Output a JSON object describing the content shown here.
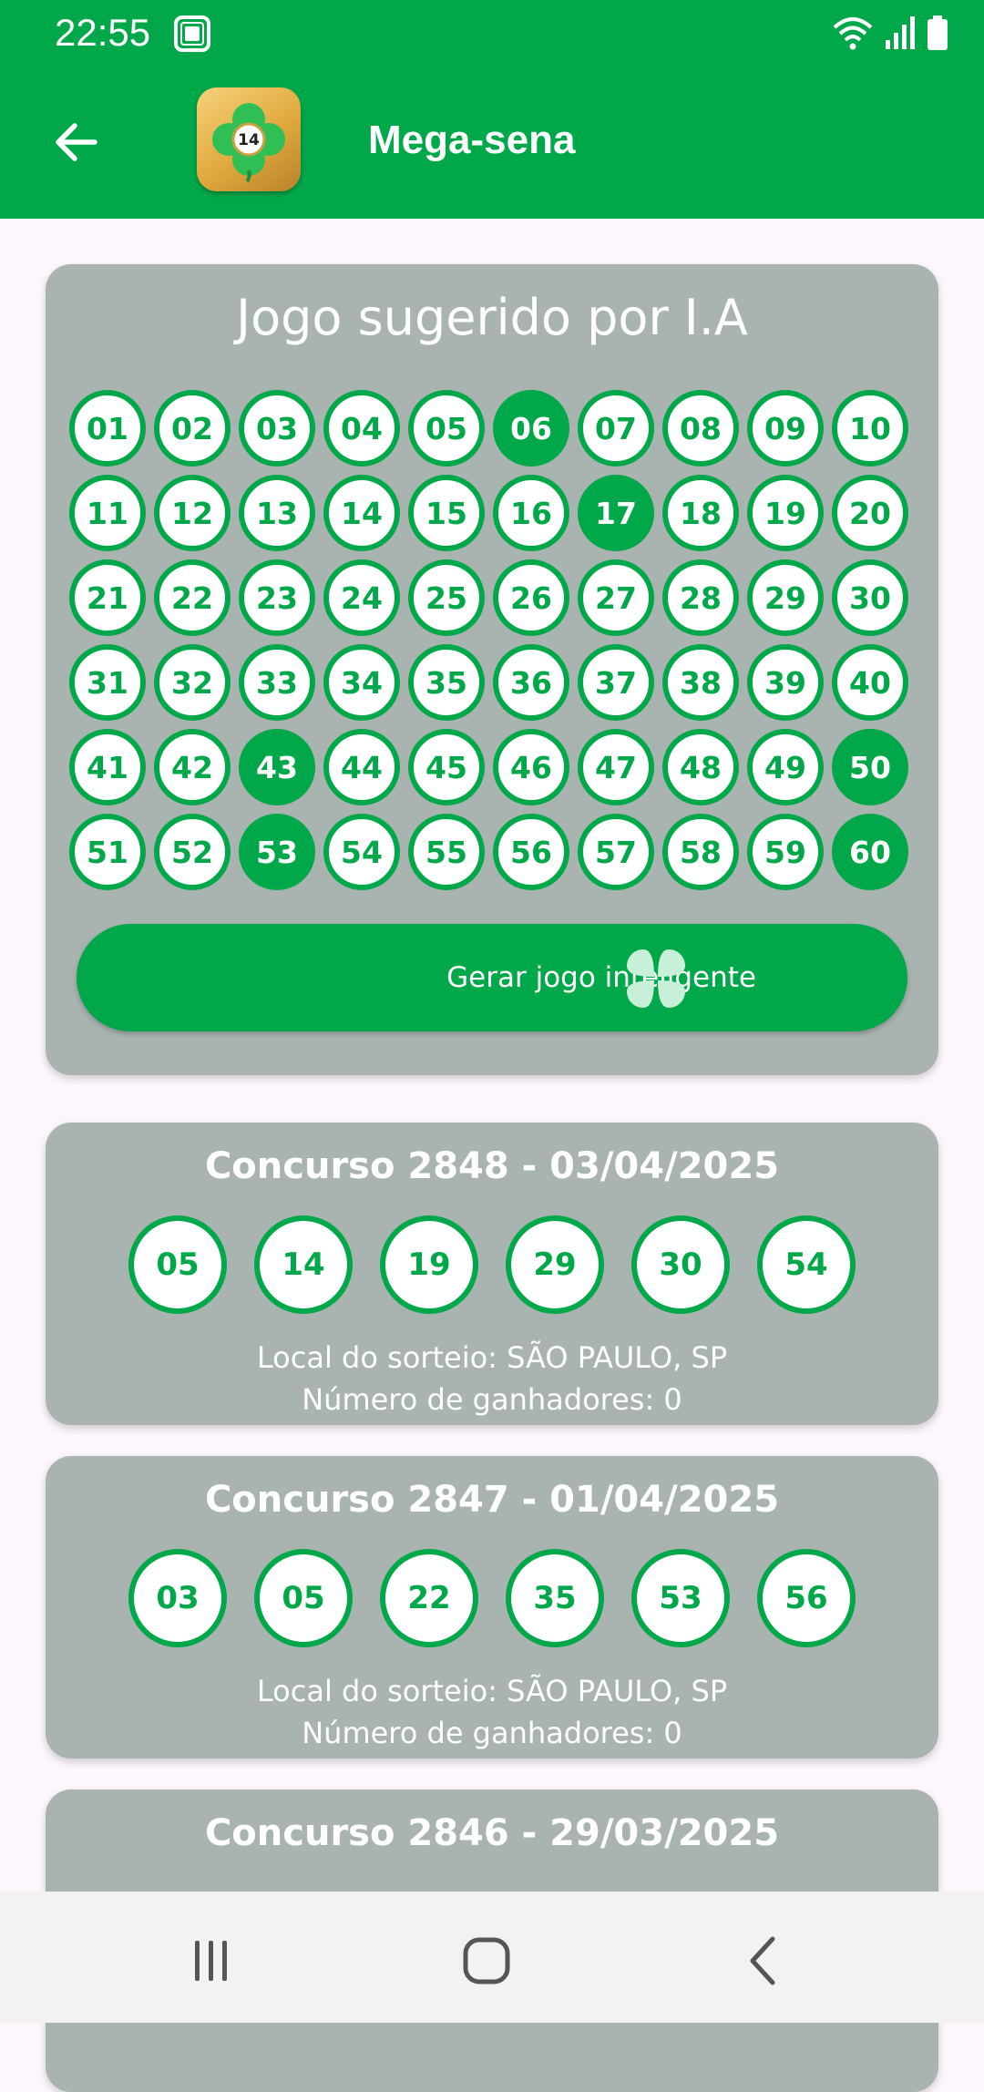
{
  "status_bar": {
    "time": "22:55"
  },
  "app_bar": {
    "title": "Mega-sena",
    "logo_number": "14"
  },
  "ai_game": {
    "title": "Jogo sugerido por I.A",
    "numbers": [
      "01",
      "02",
      "03",
      "04",
      "05",
      "06",
      "07",
      "08",
      "09",
      "10",
      "11",
      "12",
      "13",
      "14",
      "15",
      "16",
      "17",
      "18",
      "19",
      "20",
      "21",
      "22",
      "23",
      "24",
      "25",
      "26",
      "27",
      "28",
      "29",
      "30",
      "31",
      "32",
      "33",
      "34",
      "35",
      "36",
      "37",
      "38",
      "39",
      "40",
      "41",
      "42",
      "43",
      "44",
      "45",
      "46",
      "47",
      "48",
      "49",
      "50",
      "51",
      "52",
      "53",
      "54",
      "55",
      "56",
      "57",
      "58",
      "59",
      "60"
    ],
    "selected": [
      "06",
      "17",
      "43",
      "50",
      "53",
      "60"
    ],
    "button_label": "Gerar jogo inteligente"
  },
  "draws": [
    {
      "title": "Concurso 2848 - 03/04/2025",
      "numbers": [
        "05",
        "14",
        "19",
        "29",
        "30",
        "54"
      ],
      "location": "Local do sorteio: SÃO PAULO, SP",
      "winners": "Número de ganhadores: 0"
    },
    {
      "title": "Concurso 2847 - 01/04/2025",
      "numbers": [
        "03",
        "05",
        "22",
        "35",
        "53",
        "56"
      ],
      "location": "Local do sorteio: SÃO PAULO, SP",
      "winners": "Número de ganhadores: 0"
    },
    {
      "title": "Concurso 2846 - 29/03/2025",
      "numbers": [],
      "location": "",
      "winners": ""
    }
  ],
  "icons": {
    "back": "arrow-left-icon",
    "button": "four-leaf-clover-icon",
    "nav": [
      "recent-apps-icon",
      "home-icon",
      "back-chevron-icon"
    ]
  },
  "colors": {
    "primary": "#00a84a",
    "card": "#a9b4b0",
    "page_background": "#fdf7fd",
    "clover": "#c8efd8",
    "nav_icon": "#555555"
  }
}
